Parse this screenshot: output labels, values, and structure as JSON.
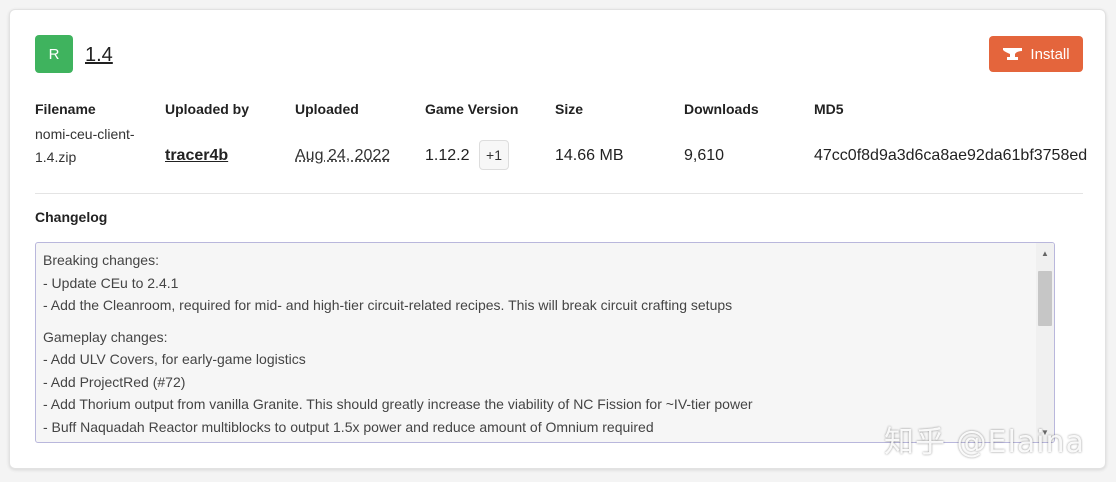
{
  "file": {
    "avatar_letter": "R",
    "version": "1.4",
    "install_label": "Install"
  },
  "columns": {
    "filename": "Filename",
    "uploaded_by": "Uploaded by",
    "uploaded": "Uploaded",
    "game_version": "Game Version",
    "size": "Size",
    "downloads": "Downloads",
    "md5": "MD5"
  },
  "values": {
    "filename_line1": "nomi-ceu-client-",
    "filename_line2": "1.4.zip",
    "uploader": "tracer4b",
    "uploaded": "Aug 24, 2022",
    "game_version": "1.12.2",
    "more_versions": "+1",
    "size": "14.66 MB",
    "downloads": "9,610",
    "md5": "47cc0f8d9a3d6ca8ae92da61bf3758ed"
  },
  "changelog": {
    "title": "Changelog",
    "sections": [
      {
        "heading": "Breaking changes:",
        "items": [
          "- Update CEu to 2.4.1",
          "- Add the Cleanroom, required for mid- and high-tier circuit-related recipes. This will break circuit crafting setups"
        ]
      },
      {
        "heading": "Gameplay changes:",
        "items": [
          "- Add ULV Covers, for early-game logistics",
          "- Add ProjectRed (#72)",
          "- Add Thorium output from vanilla Granite. This should greatly increase the viability of NC Fission for ~IV-tier power",
          "- Buff Naquadah Reactor multiblocks to output 1.5x power and reduce amount of Omnium required"
        ]
      }
    ]
  },
  "watermark": "知乎 @Elaina",
  "colors": {
    "avatar": "#3fb35e",
    "install_button": "#e4653c",
    "changelog_border": "#b9b7dc"
  },
  "icons": {
    "install": "anvil-icon",
    "scroll_up": "triangle-up-icon",
    "scroll_down": "triangle-down-icon"
  }
}
